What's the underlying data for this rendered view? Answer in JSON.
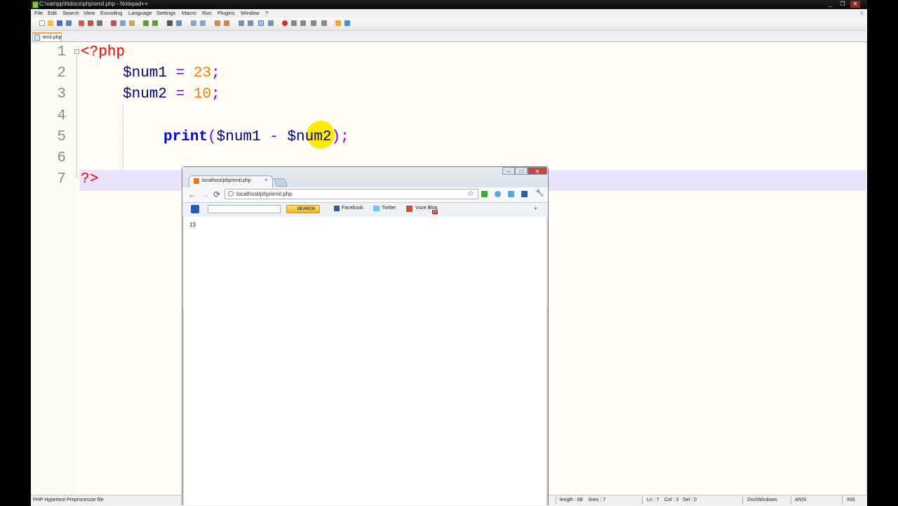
{
  "notepad": {
    "title": "C:\\xampp\\htdocs\\php\\emil.php - Notepad++",
    "window_buttons": [
      "_",
      "❐",
      "✕"
    ],
    "menu": [
      "File",
      "Edit",
      "Search",
      "View",
      "Encoding",
      "Language",
      "Settings",
      "Macro",
      "Run",
      "Plugins",
      "Window",
      "?"
    ],
    "menu_close": "X",
    "tab_label": "emil.php",
    "line_numbers": [
      "1",
      "2",
      "3",
      "4",
      "5",
      "6",
      "7"
    ],
    "code": {
      "open_tag": "<?php",
      "l2_var": "$num1",
      "l2_eq": " = ",
      "l2_val": "23",
      "l2_semi": ";",
      "l3_var": "$num2",
      "l3_eq": " = ",
      "l3_val": "10",
      "l3_semi": ";",
      "l5_print": "print",
      "l5_paren_open": "(",
      "l5_var1": "$num1",
      "l5_op": " - ",
      "l5_var2": "$num2",
      "l5_paren_close": ")",
      "l5_semi": ";",
      "close_tag": "?>"
    },
    "status": {
      "file_type": "PHP Hypertext Preprocessor file",
      "length": "length : 68",
      "lines": "lines : 7",
      "ln": "Ln : 7",
      "col": "Col : 3",
      "sel": "Sel : 0",
      "eol": "Dos\\Windows",
      "encoding": "ANSI",
      "mode": "INS"
    },
    "colors": {
      "keyword": "#0000ff",
      "variable": "#000080",
      "number": "#ff8000",
      "php_tag": "#ff0000",
      "current_line": "#ebe4ff"
    }
  },
  "browser": {
    "tab_title": "localhost/php/emil.php",
    "tab_close": "×",
    "window_buttons": [
      "–",
      "□",
      "✕"
    ],
    "back": "←",
    "forward": "→",
    "reload": "⟳",
    "url": "localhost/php/emil.php",
    "star": "☆",
    "wrench": "🔧",
    "bookmarks": {
      "search_button": "SEARCH",
      "facebook": "Facebook",
      "twitter": "Twitter",
      "voze": "Voze Blog",
      "voze_badge": "10",
      "plus": "+"
    },
    "page_output": "13"
  }
}
